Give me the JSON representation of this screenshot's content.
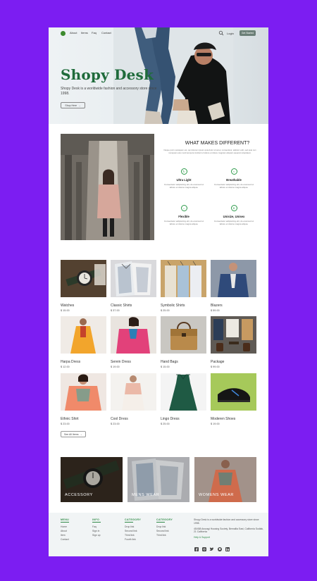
{
  "nav": {
    "items": [
      "About",
      "Items",
      "Faq",
      "Contact"
    ],
    "login": "Login",
    "cta": "Get Started"
  },
  "hero": {
    "title": "Shopy Desk",
    "subtitle": "Shopy Desk is a worldwide fashion and accessory store since 1998.",
    "button": "Shop Here"
  },
  "features": {
    "title": "WHAT MAKES DIFFERENT?",
    "description": "Neque porro quisquam est, qui dolorem ipsum quia dolor sit amet, consectetur, adipisci velit, sed quia non numquam eius modi tempora incidunt ut labore et dolore magnam aliquam quaerat voluptatem.",
    "items": [
      {
        "title": "Ultra Light",
        "desc": "Consectetur adipisicing elit, do eiusmod ut labore et dolore magna aliqua.",
        "icon": "circle-arrow-icon"
      },
      {
        "title": "Breathable",
        "desc": "Consectetur adipisicing elit, do eiusmod ut labore et dolore magna aliqua.",
        "icon": "wind-icon"
      },
      {
        "title": "Flexible",
        "desc": "Consectetur adipisicing elit, do eiusmod ut labore et dolore magna aliqua.",
        "icon": "chevron-icon"
      },
      {
        "title": "Unisize, Unisex",
        "desc": "Consectetur adipisicing elit, do eiusmod ut labore et dolore magna aliqua.",
        "icon": "dollar-icon"
      }
    ]
  },
  "products": [
    {
      "name": "Watches",
      "price": "$ 15.00"
    },
    {
      "name": "Classic Shirts",
      "price": "$ 37.00"
    },
    {
      "name": "Symbolic Shirts",
      "price": "$ 25.00"
    },
    {
      "name": "Blazers",
      "price": "$ 59.00"
    },
    {
      "name": "Harpa Dress",
      "price": "$ 12.00"
    },
    {
      "name": "Serein Dress",
      "price": "$ 19.00"
    },
    {
      "name": "Hand Bags",
      "price": "$ 15.00"
    },
    {
      "name": "Package",
      "price": "$ 99.00"
    },
    {
      "name": "Ethnic Shirt",
      "price": "$ 23.00"
    },
    {
      "name": "Cool Dress",
      "price": "$ 23.00"
    },
    {
      "name": "Lingo Dress",
      "price": "$ 25.00"
    },
    {
      "name": "Moderen Shoes",
      "price": "$ 19.00"
    }
  ],
  "see_all": "See All Items",
  "categories": [
    "ACCESSORY",
    "MENS WEAR",
    "WOMENS WEAR"
  ],
  "footer": {
    "columns": [
      {
        "title": "MENU",
        "items": [
          "Home",
          "About",
          "Item",
          "Contact"
        ]
      },
      {
        "title": "INFO",
        "items": [
          "Faq",
          "Sign in",
          "Sign up"
        ]
      },
      {
        "title": "CATEGORY",
        "items": [
          "Drop link",
          "Second link",
          "Third link",
          "Fourth link"
        ]
      },
      {
        "title": "CATEGORY",
        "items": [
          "Drop link",
          "Second link",
          "Third link"
        ]
      }
    ],
    "about": "Shopy Desk is a worldwide fashion and accessory store since 1998.",
    "address": "45/458 Anuragi Housing Society, Bemallia East, California Sodlak, 21 California",
    "help": "Help & Support",
    "social": [
      "facebook-icon",
      "instagram-icon",
      "twitter-icon",
      "github-icon",
      "linkedin-icon"
    ]
  },
  "colors": {
    "brand": "#1f6b3b",
    "accent": "#2e9b4b",
    "frame": "#7c1df2"
  }
}
